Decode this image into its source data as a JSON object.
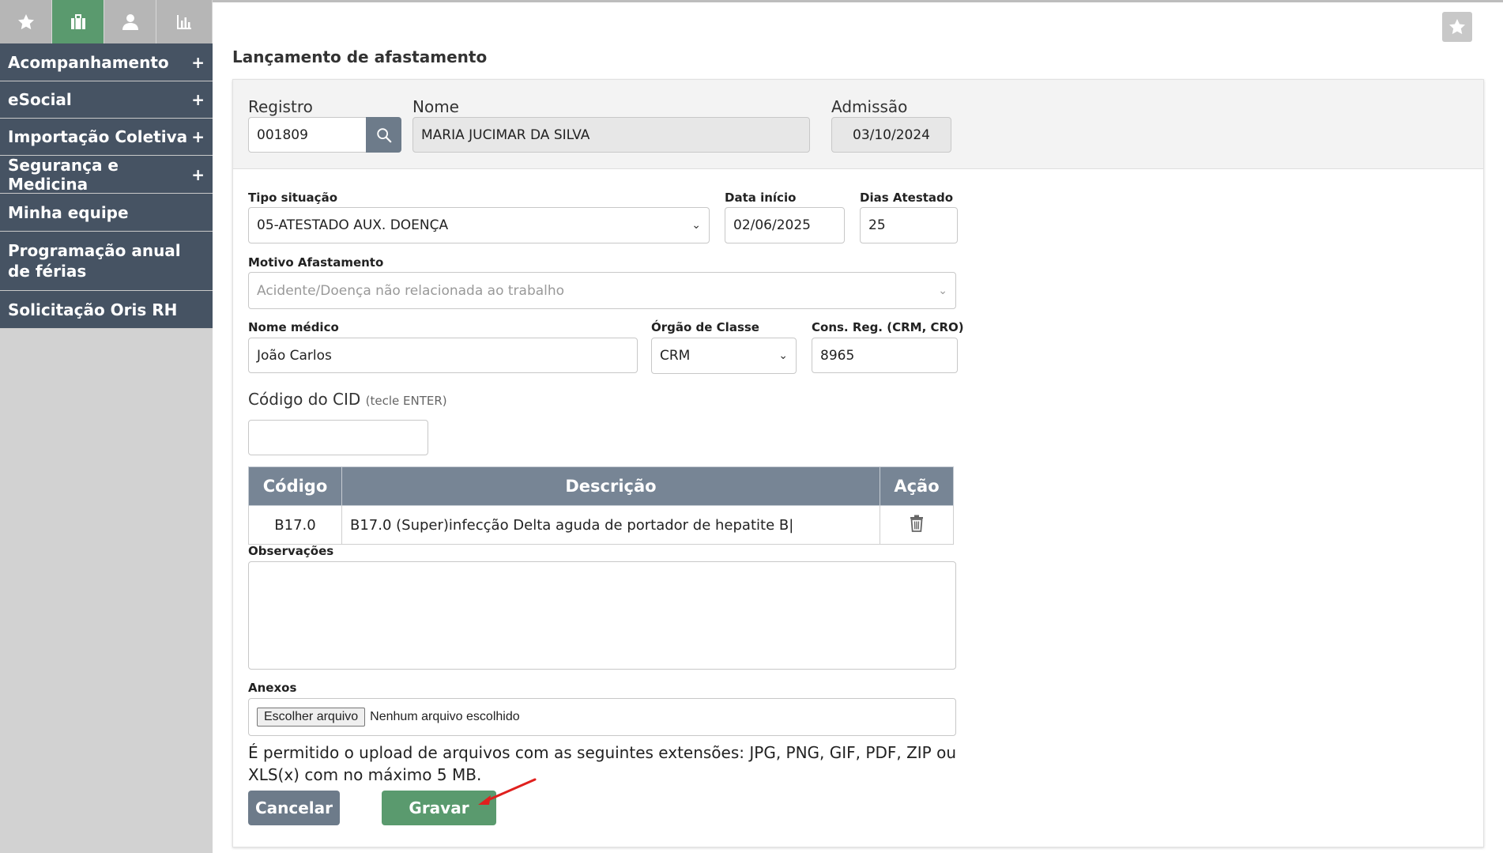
{
  "sidebar": {
    "tabs": [
      {
        "icon": "star-icon",
        "active": false
      },
      {
        "icon": "briefcase-icon",
        "active": true
      },
      {
        "icon": "user-icon",
        "active": false
      },
      {
        "icon": "bar-chart-icon",
        "active": false
      }
    ],
    "items": [
      {
        "label": "Acompanhamento",
        "expand": "+"
      },
      {
        "label": "eSocial",
        "expand": "+"
      },
      {
        "label": "Importação Coletiva",
        "expand": "+"
      },
      {
        "label": "Segurança e Medicina",
        "expand": "+"
      },
      {
        "label": "Minha equipe",
        "expand": ""
      },
      {
        "label": "Programação anual de férias",
        "expand": ""
      },
      {
        "label": "Solicitação Oris RH",
        "expand": ""
      }
    ]
  },
  "page": {
    "title": "Lançamento de afastamento"
  },
  "header": {
    "registro_label": "Registro",
    "registro_value": "001809",
    "nome_label": "Nome",
    "nome_value": "MARIA JUCIMAR DA SILVA",
    "admissao_label": "Admissão",
    "admissao_value": "03/10/2024"
  },
  "form": {
    "tipo_label": "Tipo situação",
    "tipo_value": "05-ATESTADO AUX. DOENÇA",
    "data_inicio_label": "Data início",
    "data_inicio_value": "02/06/2025",
    "dias_label": "Dias Atestado",
    "dias_value": "25",
    "motivo_label": "Motivo Afastamento",
    "motivo_value": "Acidente/Doença não relacionada ao trabalho",
    "medico_label": "Nome médico",
    "medico_value": "João Carlos",
    "orgao_label": "Órgão de Classe",
    "orgao_value": "CRM",
    "cons_label": "Cons. Reg. (CRM, CRO)",
    "cons_value": "8965",
    "cid_label": "Código do CID",
    "cid_hint": "(tecle ENTER)",
    "cid_value": "",
    "obs_label": "Observações",
    "obs_value": "",
    "anexos_label": "Anexos",
    "file_button": "Escolher arquivo",
    "file_status": "Nenhum arquivo escolhido",
    "upload_hint": "É permitido o upload de arquivos com as seguintes extensões: JPG, PNG, GIF, PDF, ZIP ou XLS(x) com no máximo 5 MB."
  },
  "cid_table": {
    "headers": [
      "Código",
      "Descrição",
      "Ação"
    ],
    "rows": [
      {
        "codigo": "B17.0",
        "descricao": "B17.0 (Super)infecção Delta aguda de portador de hepatite B|"
      }
    ]
  },
  "buttons": {
    "cancel": "Cancelar",
    "save": "Gravar"
  },
  "colors": {
    "sidebar_item_bg": "#465363",
    "active_tab": "#5a9a6e",
    "cancel_bg": "#6d7b8a",
    "save_bg": "#5a9a6e",
    "annotation_arrow": "#e0201e"
  }
}
